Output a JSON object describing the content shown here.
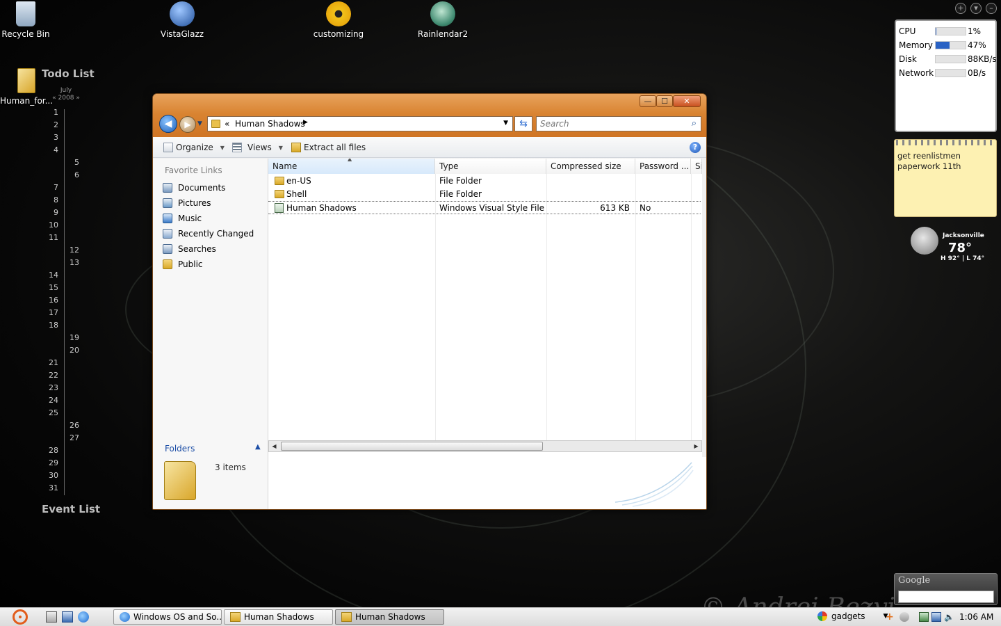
{
  "desktop": {
    "icons": [
      {
        "label": "Recycle Bin"
      },
      {
        "label": "VistaGlazz"
      },
      {
        "label": "customizing"
      },
      {
        "label": "Rainlendar2"
      },
      {
        "label": "Human_for..."
      }
    ]
  },
  "calendar": {
    "todo_title": "Todo List",
    "event_title": "Event List",
    "month": "July",
    "year": "2008",
    "prev": "«",
    "next": "»",
    "days": [
      "1",
      "2",
      "3",
      "4",
      "5",
      "6",
      "7",
      "8",
      "9",
      "10",
      "11",
      "12",
      "13",
      "14",
      "15",
      "16",
      "17",
      "18",
      "19",
      "20",
      "21",
      "22",
      "23",
      "24",
      "25",
      "26",
      "27",
      "28",
      "29",
      "30",
      "31"
    ]
  },
  "window": {
    "minimize": "—",
    "maximize": "☐",
    "close": "✕",
    "address": {
      "chevron": "«",
      "crumb": "Human Shadows",
      "arrow": "▶",
      "dropdown": "▼"
    },
    "search_placeholder": "Search",
    "toolbar": {
      "organize": "Organize",
      "views": "Views",
      "extract": "Extract all files",
      "help": "?"
    },
    "nav": {
      "favorite_links": "Favorite Links",
      "links": [
        "Documents",
        "Pictures",
        "Music",
        "Recently Changed",
        "Searches",
        "Public"
      ],
      "folders": "Folders"
    },
    "columns": [
      "Name",
      "Type",
      "Compressed size",
      "Password ...",
      "Si"
    ],
    "files": [
      {
        "name": "en-US",
        "type": "File Folder",
        "size": "",
        "password": ""
      },
      {
        "name": "Shell",
        "type": "File Folder",
        "size": "",
        "password": ""
      },
      {
        "name": "Human Shadows",
        "type": "Windows Visual Style File",
        "size": "613 KB",
        "password": "No"
      }
    ],
    "details": {
      "count": "3 items"
    }
  },
  "gadgets": {
    "sysmon": [
      {
        "label": "CPU",
        "value": "1%",
        "level": 0.01
      },
      {
        "label": "Memory",
        "value": "47%",
        "level": 0.47
      },
      {
        "label": "Disk",
        "value": "88KB/s",
        "level": 0
      },
      {
        "label": "Network",
        "value": "0B/s",
        "level": 0
      }
    ],
    "note": "get reenlistmen paperwork 11th",
    "weather": {
      "city": "Jacksonville",
      "temp": "78°",
      "hilo": "H 92° | L 74°"
    },
    "google": "Google",
    "top_buttons": [
      "+",
      "▾",
      "–"
    ]
  },
  "signature": "© Andrei Bezyi...",
  "taskbar": {
    "buttons": [
      "Windows OS and So...",
      "Human Shadows",
      "Human Shadows"
    ],
    "tray_label": "gadgets",
    "clock": "1:06 AM"
  },
  "colors": {
    "title_orange": "#d98432",
    "selection_blue": "#2a62c4"
  }
}
